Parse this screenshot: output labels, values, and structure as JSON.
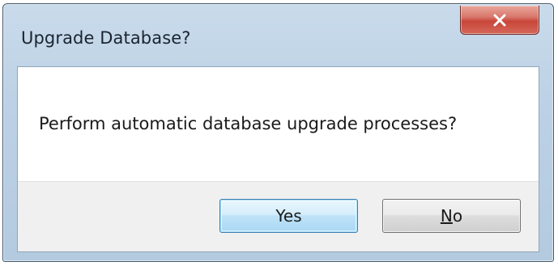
{
  "window": {
    "title": "Upgrade Database?",
    "close_icon": "close-x-icon"
  },
  "dialog": {
    "message": "Perform automatic database upgrade processes?"
  },
  "buttons": {
    "yes_label": "Yes",
    "no_mnemonic": "N",
    "no_rest": "o"
  },
  "colors": {
    "close_button": "#c8463a",
    "default_button_border": "#3c7fb1",
    "titlebar": "#bcd1e5"
  }
}
